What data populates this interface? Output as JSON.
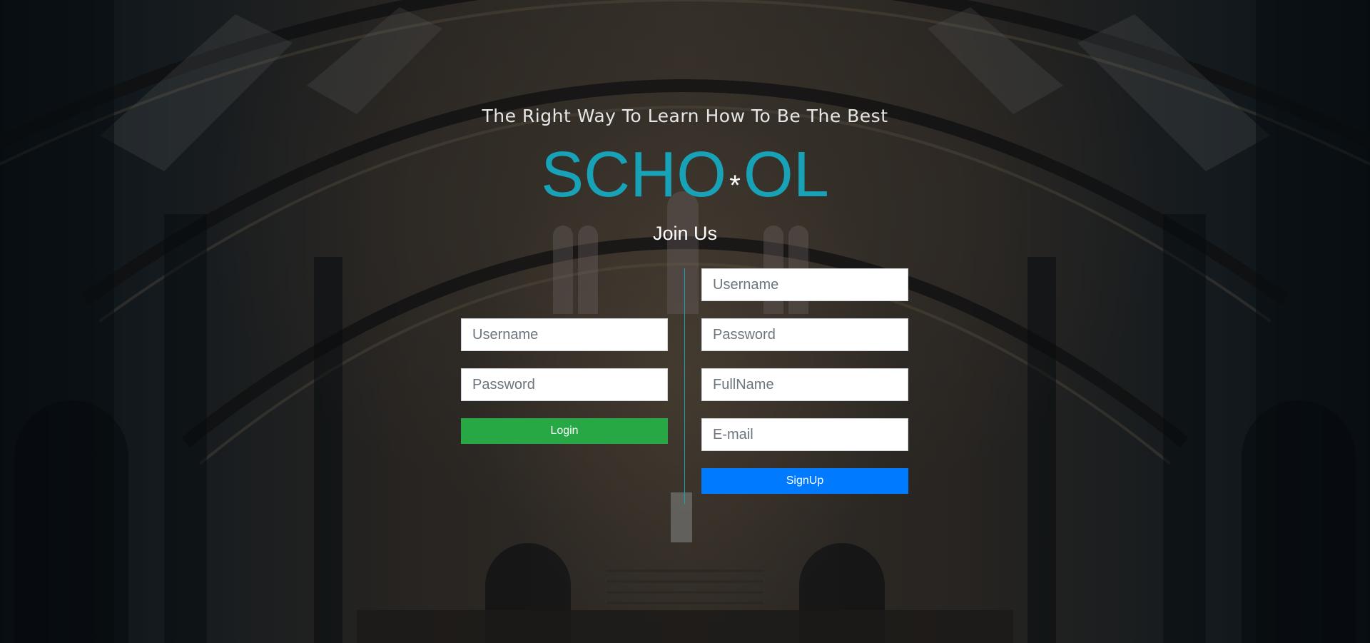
{
  "header": {
    "tagline": "The Right Way To Learn How To Be The Best",
    "logo_left": "SCHO",
    "logo_star": "*",
    "logo_right": "OL",
    "join_text": "Join Us"
  },
  "login_form": {
    "username_placeholder": "Username",
    "password_placeholder": "Password",
    "submit_label": "Login"
  },
  "signup_form": {
    "username_placeholder": "Username",
    "password_placeholder": "Password",
    "fullname_placeholder": "FullName",
    "email_placeholder": "E-mail",
    "submit_label": "SignUp"
  },
  "colors": {
    "accent": "#17a2b8",
    "login_button": "#28a745",
    "signup_button": "#007bff"
  }
}
